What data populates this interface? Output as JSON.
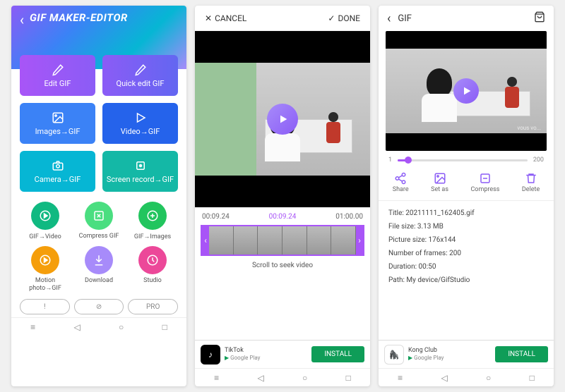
{
  "screen1": {
    "title": "GIF MAKER-EDITOR",
    "tiles": [
      {
        "label": "Edit GIF"
      },
      {
        "label": "Quick edit GIF"
      },
      {
        "label": "Images→GIF"
      },
      {
        "label": "Video→GIF"
      },
      {
        "label": "Camera→GIF"
      },
      {
        "label": "Screen record→GIF"
      }
    ],
    "circles": [
      {
        "label": "GIF→Video"
      },
      {
        "label": "Compress GIF"
      },
      {
        "label": "GIF→Images"
      },
      {
        "label": "Motion photo→GIF"
      },
      {
        "label": "Download"
      },
      {
        "label": "Studio"
      }
    ],
    "pills": [
      "!",
      "⊘",
      "PRO"
    ]
  },
  "screen2": {
    "cancel": "CANCEL",
    "done": "DONE",
    "time_start": "00:09.24",
    "time_mid": "00:09.24",
    "time_end": "01:00.00",
    "seek_label": "Scroll to seek video",
    "ad": {
      "name": "TikTok",
      "sub": "Google Play",
      "btn": "INSTALL"
    }
  },
  "screen3": {
    "title": "GIF",
    "slider_min": "1",
    "slider_max": "200",
    "actions": [
      {
        "label": "Share"
      },
      {
        "label": "Set as"
      },
      {
        "label": "Compress"
      },
      {
        "label": "Delete"
      }
    ],
    "info": {
      "title": "Title: 20211111_162405.gif",
      "filesize": "File size: 3.13 MB",
      "picsize": "Picture size: 176x144",
      "frames": "Number of frames: 200",
      "duration": "Duration: 00:50",
      "path": "Path: My device/GifStudio"
    },
    "ad": {
      "name": "Kong Club",
      "sub": "Google Play",
      "btn": "INSTALL"
    }
  }
}
